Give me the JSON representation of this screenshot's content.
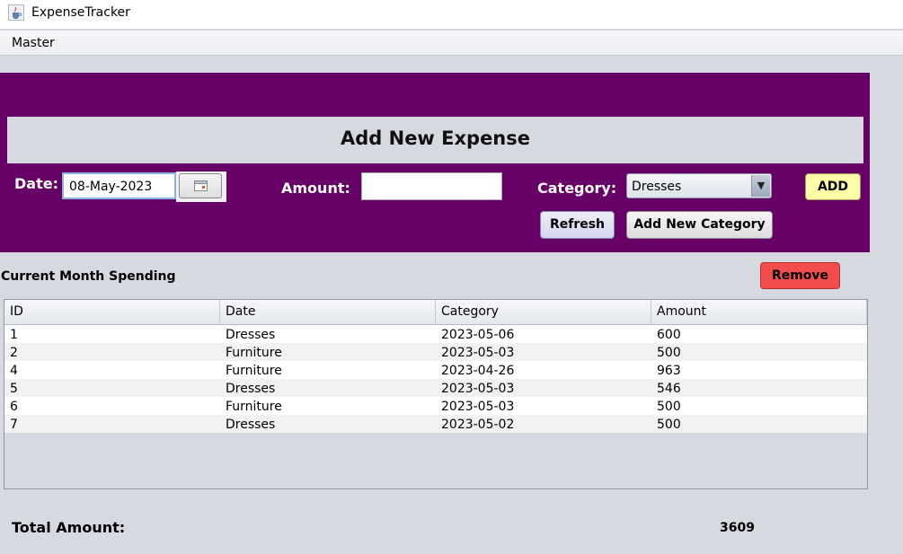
{
  "window": {
    "title": "ExpenseTracker"
  },
  "menu": {
    "items": [
      "Master"
    ]
  },
  "form": {
    "header": "Add New Expense",
    "date_label": "Date:",
    "date_value": "08-May-2023",
    "amount_label": "Amount:",
    "amount_value": "",
    "category_label": "Category:",
    "category_selected": "Dresses",
    "add_label": "ADD",
    "refresh_label": "Refresh",
    "add_category_label": "Add New Category"
  },
  "list": {
    "title": "Current Month Spending",
    "remove_label": "Remove",
    "columns": [
      "ID",
      "Date",
      "Category",
      "Amount"
    ],
    "rows": [
      [
        "1",
        "Dresses",
        "2023-05-06",
        "600"
      ],
      [
        "2",
        "Furniture",
        "2023-05-03",
        "500"
      ],
      [
        "4",
        "Furniture",
        "2023-04-26",
        "963"
      ],
      [
        "5",
        "Dresses",
        "2023-05-03",
        "546"
      ],
      [
        "6",
        "Furniture",
        "2023-05-03",
        "500"
      ],
      [
        "7",
        "Dresses",
        "2023-05-02",
        "500"
      ]
    ]
  },
  "total": {
    "label": "Total Amount:",
    "value": "3609"
  },
  "colors": {
    "panel": "#660066",
    "add_button": "#ffffa8",
    "remove_button": "#f24c4c",
    "background": "#d6d9df"
  },
  "icons": {
    "app": "java-coffee-cup-icon",
    "calendar": "calendar-icon",
    "dropdown": "triangle-down-icon"
  }
}
